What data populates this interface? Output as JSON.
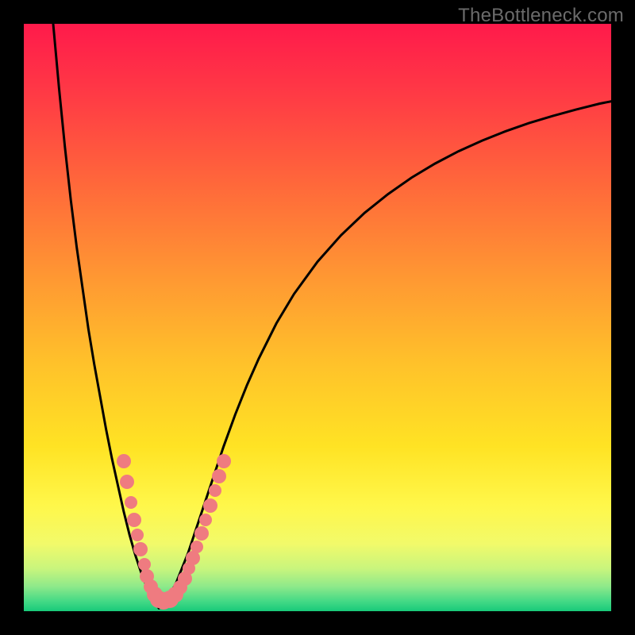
{
  "watermark": "TheBottleneck.com",
  "colors": {
    "frame_bg": "#000000",
    "curve_stroke": "#000000",
    "dot_fill": "#ef7b80",
    "gradient_stops": [
      {
        "offset": 0.0,
        "color": "#ff1a4b"
      },
      {
        "offset": 0.12,
        "color": "#ff3a45"
      },
      {
        "offset": 0.28,
        "color": "#ff6a3a"
      },
      {
        "offset": 0.44,
        "color": "#ff9a32"
      },
      {
        "offset": 0.58,
        "color": "#ffc22a"
      },
      {
        "offset": 0.72,
        "color": "#ffe324"
      },
      {
        "offset": 0.82,
        "color": "#fff74a"
      },
      {
        "offset": 0.885,
        "color": "#f2fa6a"
      },
      {
        "offset": 0.928,
        "color": "#c8f57d"
      },
      {
        "offset": 0.958,
        "color": "#8ee98a"
      },
      {
        "offset": 0.985,
        "color": "#3fd885"
      },
      {
        "offset": 1.0,
        "color": "#18c97a"
      }
    ]
  },
  "chart_data": {
    "type": "line",
    "title": "",
    "xlabel": "",
    "ylabel": "",
    "xlim": [
      0,
      100
    ],
    "ylim": [
      0,
      100
    ],
    "vertex_x": 23,
    "series": [
      {
        "name": "left-branch",
        "x": [
          5.0,
          6.0,
          7.0,
          8.0,
          9.0,
          10.0,
          11.0,
          12.0,
          13.0,
          14.0,
          15.0,
          16.0,
          17.0,
          18.0,
          19.0,
          20.0,
          21.0,
          22.0,
          23.0
        ],
        "y": [
          100.0,
          89.0,
          79.0,
          70.0,
          62.0,
          55.0,
          48.0,
          42.0,
          36.5,
          31.0,
          26.0,
          21.5,
          17.0,
          13.0,
          9.5,
          6.5,
          4.0,
          2.0,
          0.5
        ]
      },
      {
        "name": "right-branch",
        "x": [
          23.0,
          24.0,
          25.0,
          26.0,
          27.0,
          28.0,
          29.0,
          30.0,
          32.0,
          34.0,
          36.0,
          38.0,
          40.0,
          43.0,
          46.0,
          50.0,
          54.0,
          58.0,
          62.0,
          66.0,
          70.0,
          74.0,
          78.0,
          82.0,
          86.0,
          90.0,
          94.0,
          98.0,
          100.0
        ],
        "y": [
          0.5,
          1.5,
          3.0,
          5.0,
          7.5,
          10.0,
          13.0,
          16.0,
          22.0,
          28.0,
          33.5,
          38.5,
          43.0,
          49.0,
          54.0,
          59.5,
          64.0,
          67.8,
          71.0,
          73.8,
          76.2,
          78.3,
          80.1,
          81.7,
          83.1,
          84.3,
          85.4,
          86.4,
          86.8
        ]
      }
    ],
    "dots": {
      "name": "highlight-dots",
      "fill": "#ef7b80",
      "radius_range": [
        7,
        12
      ],
      "points": [
        {
          "x": 17.0,
          "y": 25.5,
          "r": 9
        },
        {
          "x": 17.6,
          "y": 22.0,
          "r": 9
        },
        {
          "x": 18.3,
          "y": 18.5,
          "r": 8
        },
        {
          "x": 18.8,
          "y": 15.5,
          "r": 9
        },
        {
          "x": 19.3,
          "y": 13.0,
          "r": 8
        },
        {
          "x": 19.9,
          "y": 10.5,
          "r": 9
        },
        {
          "x": 20.5,
          "y": 8.0,
          "r": 8
        },
        {
          "x": 21.0,
          "y": 6.0,
          "r": 9
        },
        {
          "x": 21.6,
          "y": 4.2,
          "r": 9
        },
        {
          "x": 22.3,
          "y": 2.8,
          "r": 10
        },
        {
          "x": 23.0,
          "y": 2.0,
          "r": 11
        },
        {
          "x": 23.8,
          "y": 1.8,
          "r": 11
        },
        {
          "x": 24.8,
          "y": 2.0,
          "r": 11
        },
        {
          "x": 25.8,
          "y": 2.8,
          "r": 10
        },
        {
          "x": 26.6,
          "y": 4.0,
          "r": 9
        },
        {
          "x": 27.4,
          "y": 5.6,
          "r": 9
        },
        {
          "x": 28.1,
          "y": 7.3,
          "r": 8
        },
        {
          "x": 28.8,
          "y": 9.0,
          "r": 9
        },
        {
          "x": 29.5,
          "y": 11.0,
          "r": 8
        },
        {
          "x": 30.3,
          "y": 13.2,
          "r": 9
        },
        {
          "x": 31.0,
          "y": 15.5,
          "r": 8
        },
        {
          "x": 31.8,
          "y": 18.0,
          "r": 9
        },
        {
          "x": 32.5,
          "y": 20.5,
          "r": 8
        },
        {
          "x": 33.3,
          "y": 23.0,
          "r": 9
        },
        {
          "x": 34.0,
          "y": 25.5,
          "r": 9
        }
      ]
    }
  }
}
